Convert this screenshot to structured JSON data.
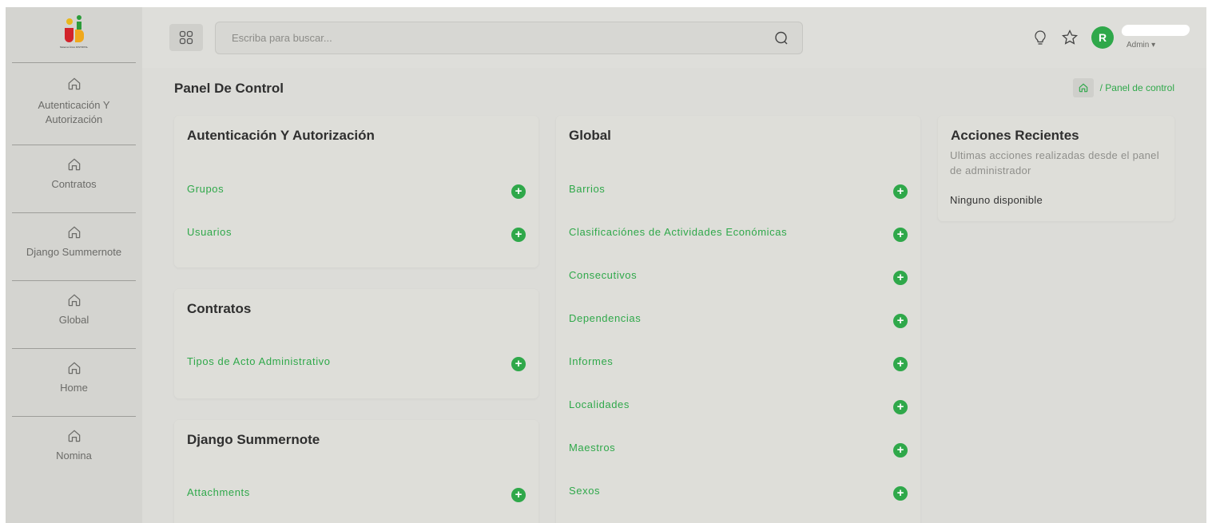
{
  "sidebar": {
    "logo_text": "Sistema Único DISTRITAL",
    "items": [
      {
        "label": "Autenticación Y Autorización"
      },
      {
        "label": "Contratos"
      },
      {
        "label": "Django Summernote"
      },
      {
        "label": "Global"
      },
      {
        "label": "Home"
      },
      {
        "label": "Nomina"
      }
    ]
  },
  "topbar": {
    "search_placeholder": "Escriba para buscar...",
    "avatar_initial": "R",
    "user_role": "Admin ▾"
  },
  "page": {
    "title": "Panel De Control",
    "breadcrumb": "/ Panel de control"
  },
  "cards": {
    "auth": {
      "title": "Autenticación Y Autorización",
      "rows": [
        {
          "label": "Grupos"
        },
        {
          "label": "Usuarios"
        }
      ]
    },
    "contratos": {
      "title": "Contratos",
      "rows": [
        {
          "label": "Tipos de Acto Administrativo"
        }
      ]
    },
    "summernote": {
      "title": "Django Summernote",
      "rows": [
        {
          "label": "Attachments"
        }
      ]
    },
    "global": {
      "title": "Global",
      "rows": [
        {
          "label": "Barrios"
        },
        {
          "label": "Clasificaciónes de Actividades Económicas"
        },
        {
          "label": "Consecutivos"
        },
        {
          "label": "Dependencias"
        },
        {
          "label": "Informes"
        },
        {
          "label": "Localidades"
        },
        {
          "label": "Maestros"
        },
        {
          "label": "Sexos"
        }
      ]
    },
    "recent": {
      "title": "Acciones Recientes",
      "subtitle": "Ultimas acciones realizadas desde el panel de administrador",
      "empty": "Ninguno disponible"
    }
  },
  "add_symbol": "+",
  "colors": {
    "accent": "#2fa84a",
    "background": "#dcdcd8",
    "sidebar": "#d4d4d0"
  }
}
